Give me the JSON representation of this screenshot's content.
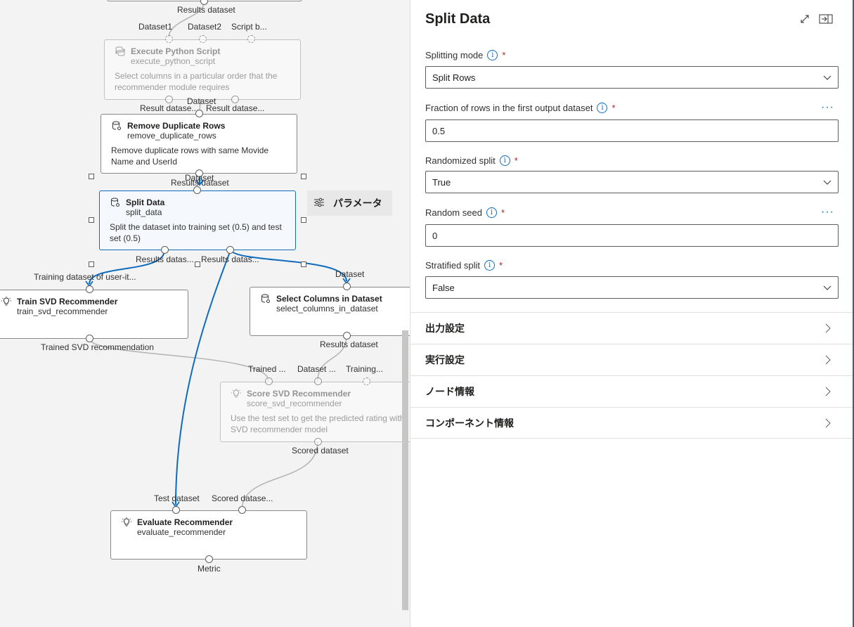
{
  "canvas": {
    "ports": {
      "results_dataset_top": "Results dataset",
      "dataset1": "Dataset1",
      "dataset2": "Dataset2",
      "script_bundle": "Script b...",
      "result_dataset_1": "Result datase...",
      "dataset_rd_in": "Dataset",
      "result_dataset_2": "Result datase...",
      "dataset_sd_in": "Dataset",
      "results_dataset_rd": "Results dataset",
      "results_datas_1": "Results datas...",
      "results_datas_2": "Results datas...",
      "training_dataset": "Training dataset of user-it...",
      "dataset_sc_in": "Dataset",
      "trained_svd": "Trained SVD recommendation",
      "results_dataset_sc": "Results dataset",
      "trained_in": "Trained ...",
      "dataset_score_in": "Dataset ...",
      "training_in": "Training...",
      "scored_dataset": "Scored dataset",
      "test_dataset": "Test dataset",
      "scored_datase_in": "Scored datase...",
      "metric": "Metric"
    },
    "nodes": {
      "execute_python": {
        "title": "Execute Python Script",
        "name": "execute_python_script",
        "desc": "Select columns in a particular order that the recommender module requires"
      },
      "remove_duplicates": {
        "title": "Remove Duplicate Rows",
        "name": "remove_duplicate_rows",
        "desc": "Remove duplicate rows with same Movide Name and UserId"
      },
      "split_data": {
        "title": "Split Data",
        "name": "split_data",
        "desc": "Split the dataset into training set (0.5) and test set (0.5)"
      },
      "train_svd": {
        "title": "Train SVD Recommender",
        "name": "train_svd_recommender"
      },
      "select_columns": {
        "title": "Select Columns in Dataset",
        "name": "select_columns_in_dataset"
      },
      "score_svd": {
        "title": "Score SVD Recommender",
        "name": "score_svd_recommender",
        "desc": "Use the test set to get the predicted rating with SVD recommender model"
      },
      "evaluate": {
        "title": "Evaluate Recommender",
        "name": "evaluate_recommender"
      }
    },
    "param_chip": {
      "label": "パラメータ"
    },
    "colors": {
      "selected_edge": "#0f6cbd",
      "edge": "#b5b3b1"
    }
  },
  "panel": {
    "title": "Split Data",
    "fields": {
      "splitting_mode": {
        "label": "Splitting mode",
        "required": "*",
        "value": "Split Rows"
      },
      "fraction": {
        "label": "Fraction of rows in the first output dataset",
        "required": "*",
        "value": "0.5",
        "more": "···"
      },
      "randomized": {
        "label": "Randomized split",
        "required": "*",
        "value": "True"
      },
      "seed": {
        "label": "Random seed",
        "required": "*",
        "value": "0",
        "more": "···"
      },
      "stratified": {
        "label": "Stratified split",
        "required": "*",
        "value": "False"
      }
    },
    "sections": {
      "output": "出力設定",
      "run": "実行設定",
      "node": "ノード情報",
      "component": "コンポーネント情報"
    },
    "info_glyph": "i",
    "colors": {
      "accent": "#0f6cbd",
      "required": "#a4262c"
    }
  }
}
